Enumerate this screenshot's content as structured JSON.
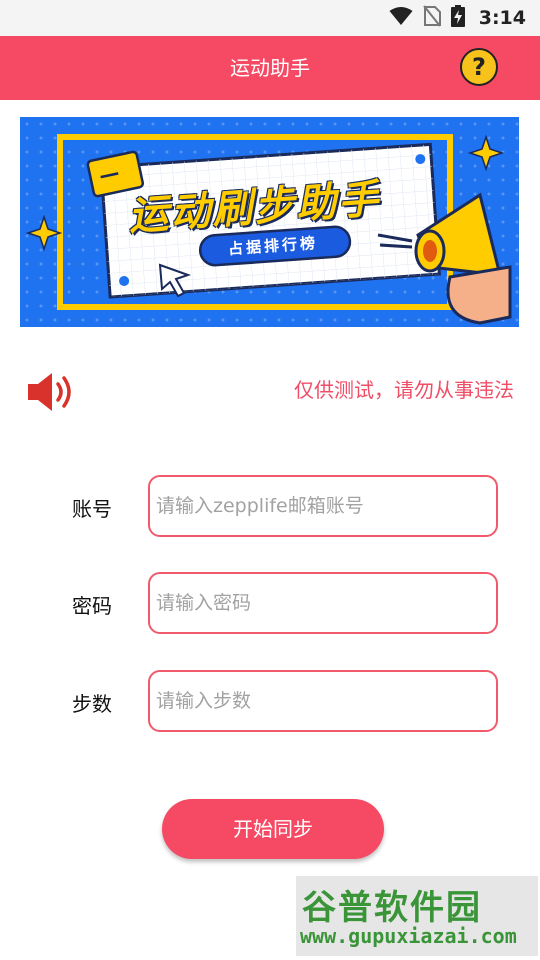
{
  "status_bar": {
    "time": "3:14",
    "icons": [
      "wifi-icon",
      "no-sim-icon",
      "battery-charging-icon"
    ]
  },
  "app_bar": {
    "title": "运动助手",
    "help_icon": "help-question-icon",
    "color": "#f64a64"
  },
  "banner": {
    "title": "运动刷步助手",
    "subtitle": "占据排行榜",
    "colors": {
      "background": "#1f72f0",
      "accent": "#ffcc00"
    }
  },
  "notice": {
    "icon": "speaker-icon",
    "text": "仅供测试，请勿从事违法"
  },
  "form": {
    "account": {
      "label": "账号",
      "placeholder": "请输入zepplife邮箱账号",
      "value": ""
    },
    "password": {
      "label": "密码",
      "placeholder": "请输入密码",
      "value": ""
    },
    "steps": {
      "label": "步数",
      "placeholder": "请输入步数",
      "value": ""
    }
  },
  "start_button": {
    "label": "开始同步"
  },
  "watermark": {
    "title": "谷普软件园",
    "url": "www.gupuxiazai.com"
  }
}
